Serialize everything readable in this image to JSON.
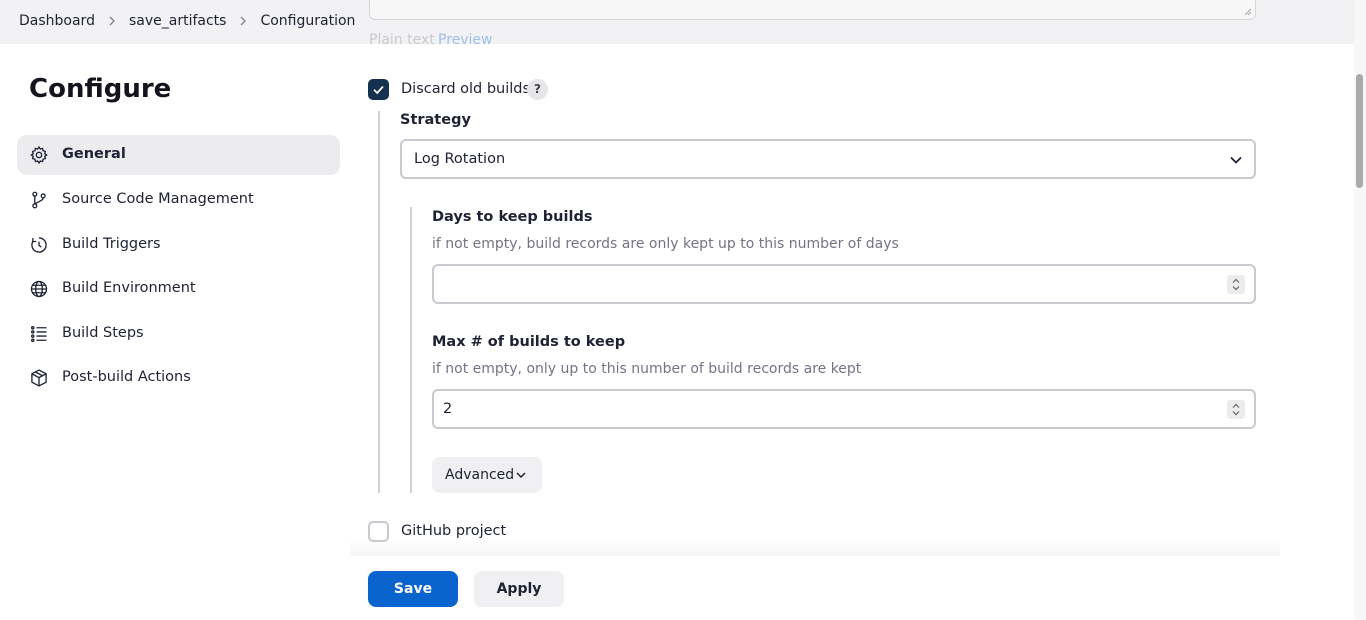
{
  "breadcrumb": {
    "items": [
      "Dashboard",
      "save_artifacts",
      "Configuration"
    ]
  },
  "description_editor": {
    "plain_text_label": "Plain text",
    "preview_label": "Preview"
  },
  "page": {
    "title": "Configure"
  },
  "sidebar": {
    "items": [
      {
        "label": "General",
        "icon": "gear-icon",
        "active": true
      },
      {
        "label": "Source Code Management",
        "icon": "git-branch-icon",
        "active": false
      },
      {
        "label": "Build Triggers",
        "icon": "clock-icon",
        "active": false
      },
      {
        "label": "Build Environment",
        "icon": "globe-icon",
        "active": false
      },
      {
        "label": "Build Steps",
        "icon": "list-icon",
        "active": false
      },
      {
        "label": "Post-build Actions",
        "icon": "package-icon",
        "active": false
      }
    ]
  },
  "discard_old_builds": {
    "label": "Discard old builds",
    "checked": true,
    "help_label": "?",
    "strategy_label": "Strategy",
    "strategy_value": "Log Rotation",
    "days_label": "Days to keep builds",
    "days_desc": "if not empty, build records are only kept up to this number of days",
    "days_value": "",
    "max_label": "Max # of builds to keep",
    "max_desc": "if not empty, only up to this number of build records are kept",
    "max_value": "2",
    "advanced_label": "Advanced"
  },
  "github_project": {
    "label": "GitHub project",
    "checked": false
  },
  "actions": {
    "save_label": "Save",
    "apply_label": "Apply"
  },
  "colors": {
    "primary": "#0b63ce",
    "checkbox_checked": "#14324f"
  }
}
